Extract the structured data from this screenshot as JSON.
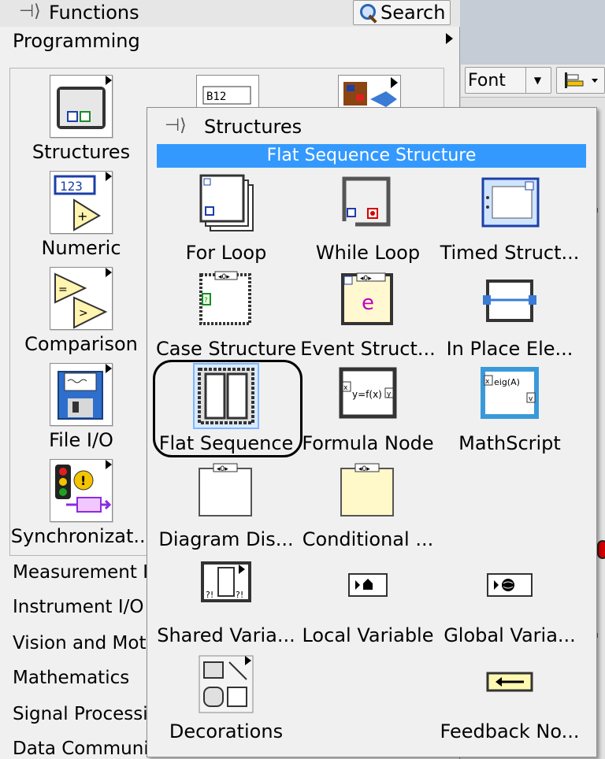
{
  "functions_palette": {
    "title": "Functions",
    "search_label": "Search",
    "programming_label": "Programming",
    "items": [
      {
        "label": "Structures"
      },
      {
        "label": "Numeric"
      },
      {
        "label": "Comparison"
      },
      {
        "label": "File I/O"
      },
      {
        "label": "Synchronizat..."
      }
    ],
    "categories": [
      {
        "label": "Measurement I"
      },
      {
        "label": "Instrument I/O"
      },
      {
        "label": "Vision and Mot"
      },
      {
        "label": "Mathematics"
      },
      {
        "label": "Signal Processi"
      },
      {
        "label": "Data Communi"
      }
    ]
  },
  "structures_palette": {
    "title": "Structures",
    "highlight_text": "Flat Sequence Structure",
    "items": [
      {
        "label": "For Loop",
        "icon": "for-loop-icon"
      },
      {
        "label": "While Loop",
        "icon": "while-loop-icon"
      },
      {
        "label": "Timed Struct...",
        "icon": "timed-structure-icon"
      },
      {
        "label": "Case Structure",
        "icon": "case-structure-icon"
      },
      {
        "label": "Event Struct...",
        "icon": "event-structure-icon"
      },
      {
        "label": "In Place Ele...",
        "icon": "in-place-element-icon"
      },
      {
        "label": "Flat Sequence",
        "icon": "flat-sequence-icon"
      },
      {
        "label": "Formula Node",
        "icon": "formula-node-icon"
      },
      {
        "label": "MathScript",
        "icon": "mathscript-icon"
      },
      {
        "label": "Diagram Dis...",
        "icon": "diagram-disable-icon"
      },
      {
        "label": "Conditional ...",
        "icon": "conditional-disable-icon"
      },
      {
        "label": "Shared Varia...",
        "icon": "shared-variable-icon"
      },
      {
        "label": "Local Variable",
        "icon": "local-variable-icon"
      },
      {
        "label": "Global Varia...",
        "icon": "global-variable-icon"
      },
      {
        "label": "Decorations",
        "icon": "decorations-icon"
      },
      {
        "label": "Feedback No...",
        "icon": "feedback-node-icon"
      }
    ]
  },
  "toolbar": {
    "font_label": "Font"
  }
}
